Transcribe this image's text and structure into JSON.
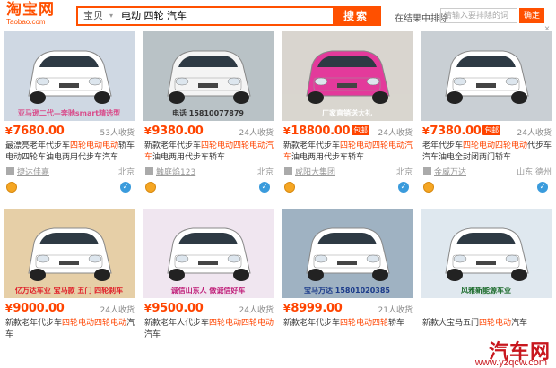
{
  "header": {
    "logo_main": "淘宝网",
    "logo_sub": "Taobao.com",
    "search_category": "宝贝",
    "search_query": "电动 四轮 汽车",
    "search_button": "搜索",
    "filter_label": "在结果中排除",
    "filter_placeholder": "请输入要排除的词",
    "filter_button": "确定"
  },
  "products": [
    {
      "price": "7680.00",
      "sales": "53人收货",
      "badge": "",
      "title_pre": "最漂亮老年代步车",
      "title_hl": "四轮电动电动",
      "title_post": "轿车电动四轮车油电两用代步车汽车",
      "shop": "捷达佳嘉",
      "location": "北京",
      "img_caption": "亚马逊二代—奔驰smart精选型"
    },
    {
      "price": "9380.00",
      "sales": "24人收货",
      "badge": "",
      "title_pre": "新款老年代步车",
      "title_hl": "四轮电动四轮电动汽车",
      "title_post": "油电两用代步车轿车",
      "shop": "触庭焰123",
      "location": "北京",
      "img_caption": "电话 15810077879"
    },
    {
      "price": "18800.00",
      "sales": "24人收货",
      "badge": "包邮",
      "title_pre": "新款老年代步车",
      "title_hl": "四轮电动四轮电动汽车",
      "title_post": "油电两用代步车轿车",
      "shop": "咸阳大集团",
      "location": "北京",
      "img_caption": "厂家直销送大礼"
    },
    {
      "price": "7380.00",
      "sales": "24人收货",
      "badge": "包邮",
      "title_pre": "老年代步车",
      "title_hl": "四轮电动四轮电动",
      "title_post": "代步车汽车油电全封闭两门轿车",
      "shop": "金威万达",
      "location": "山东 德州",
      "img_caption": ""
    },
    {
      "price": "9000.00",
      "sales": "24人收货",
      "badge": "",
      "title_pre": "新款老年代步车",
      "title_hl": "四轮电动四轮电动",
      "title_post": "汽车",
      "shop": "",
      "location": "",
      "img_caption": "亿万达车业 宝马款 五门 四轮刹车"
    },
    {
      "price": "9500.00",
      "sales": "24人收货",
      "badge": "",
      "title_pre": "新款老年人代步车",
      "title_hl": "四轮电动四轮电动",
      "title_post": "汽车",
      "shop": "",
      "location": "",
      "img_caption": "诚信山东人 做诚信好车"
    },
    {
      "price": "8999.00",
      "sales": "21人收货",
      "badge": "",
      "title_pre": "新款老年代步车",
      "title_hl": "四轮电动四轮",
      "title_post": "轿车",
      "shop": "",
      "location": "",
      "img_caption": "宝马万达 15801020385"
    },
    {
      "price": "",
      "sales": "",
      "badge": "",
      "title_pre": "新款大宝马五门",
      "title_hl": "四轮电动",
      "title_post": "汽车",
      "shop": "",
      "location": "",
      "img_caption": "风雅新能源车业"
    }
  ],
  "watermark": {
    "main": "汽车网",
    "url": "www.yzqcw.com"
  },
  "colors": {
    "accent": "#ff5000",
    "price": "#ff4400"
  }
}
